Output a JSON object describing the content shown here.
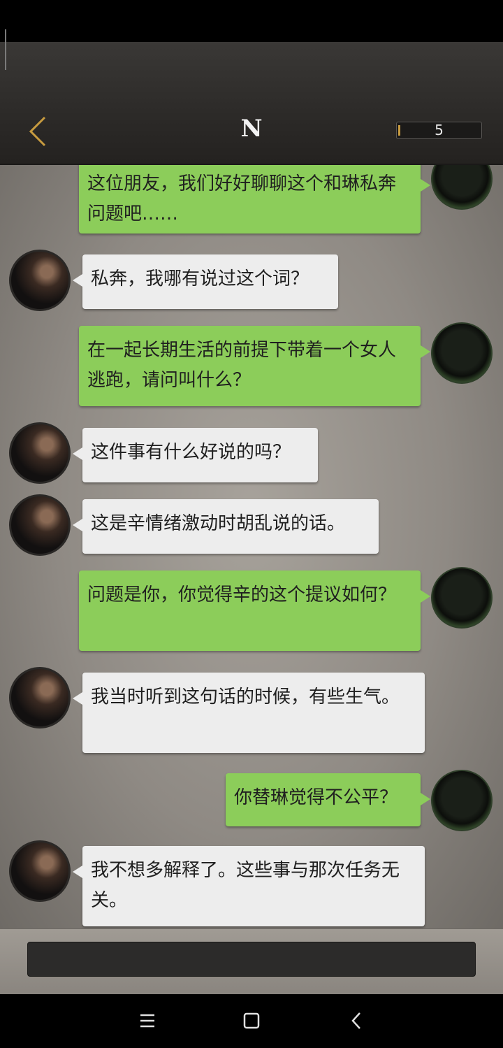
{
  "header": {
    "title": "N",
    "counter": "5",
    "accent": "#c79b3f"
  },
  "messages": [
    {
      "from": "me",
      "text": "这位朋友，我们好好聊聊这个和琳私奔问题吧……"
    },
    {
      "from": "them",
      "text": "私奔，我哪有说过这个词？"
    },
    {
      "from": "me",
      "text": "在一起长期生活的前提下带着一个女人逃跑，请问叫什么？"
    },
    {
      "from": "them",
      "text": "这件事有什么好说的吗？"
    },
    {
      "from": "them",
      "text": "这是辛情绪激动时胡乱说的话。"
    },
    {
      "from": "me",
      "text": "问题是你，你觉得辛的这个提议如何？"
    },
    {
      "from": "them",
      "text": "我当时听到这句话的时候，有些生气。"
    },
    {
      "from": "me",
      "text": "你替琳觉得不公平？"
    },
    {
      "from": "them",
      "text": "我不想多解释了。这些事与那次任务无关。"
    }
  ],
  "colors": {
    "bubble_me": "#8ccd5a",
    "bubble_them": "#ededed"
  },
  "icons": {
    "back": "chevron-left-icon",
    "nav_menu": "menu-icon",
    "nav_home": "square-icon",
    "nav_back": "back-icon"
  }
}
